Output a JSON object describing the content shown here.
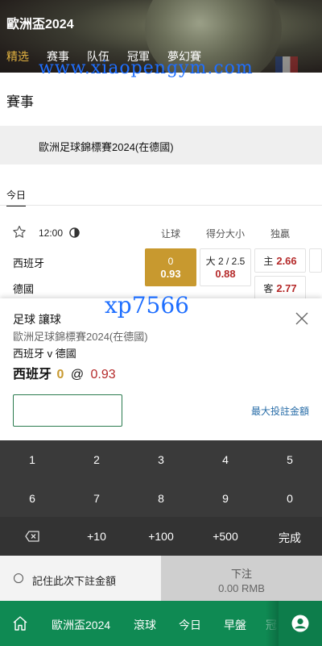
{
  "header": {
    "title": "歐洲盃2024",
    "nav": [
      "精选",
      "赛事",
      "队伍",
      "冠軍",
      "夢幻賽"
    ],
    "active_nav": 0
  },
  "watermarks": [
    "www.xiaopengym.com",
    "xp7566"
  ],
  "section_title": "賽事",
  "league": "歐洲足球錦標賽2024(在德國)",
  "date_tab": "今日",
  "match": {
    "time": "12:00",
    "columns": [
      "让球",
      "得分大小",
      "独贏"
    ],
    "home": "西班牙",
    "away": "德國",
    "handicap": {
      "line": "0",
      "odds": "0.93"
    },
    "over_under": {
      "line": "大 2 / 2.5",
      "odds": "0.88"
    },
    "moneyline_home": {
      "label": "主",
      "odds": "2.66"
    },
    "moneyline_away": {
      "label": "客",
      "odds": "2.77"
    }
  },
  "bet_slip": {
    "type": "足球 讓球",
    "league": "歐洲足球錦標賽2024(在德國)",
    "match": "西班牙 v 德國",
    "selection": "西班牙",
    "handicap": "0",
    "at": "@",
    "price": "0.93",
    "stake_placeholder": "",
    "max_stake_link": "最大投註金額"
  },
  "keypad": {
    "row1": [
      "1",
      "2",
      "3",
      "4",
      "5"
    ],
    "row2": [
      "6",
      "7",
      "8",
      "9",
      "0"
    ],
    "row3": [
      "+10",
      "+100",
      "+500",
      "完成"
    ]
  },
  "remember_label": "記住此次下註金額",
  "submit": {
    "label": "下注",
    "amount": "0.00 RMB"
  },
  "bottom_nav": [
    "歐洲盃2024",
    "滾球",
    "今日",
    "早盤",
    "冠"
  ],
  "colors": {
    "accent_green": "#0f8a53",
    "selected_gold": "#c8992f",
    "odds_red": "#b52a2a"
  }
}
